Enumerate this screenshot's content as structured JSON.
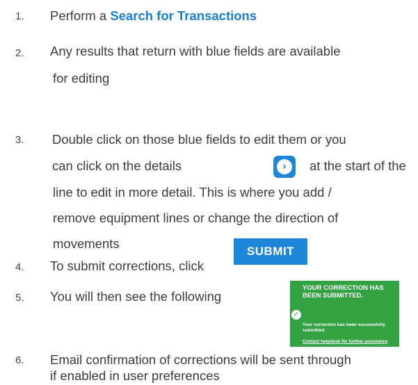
{
  "steps": [
    {
      "number": "1.",
      "prefix": "Perform a ",
      "link": "Search for Transactions"
    },
    {
      "number": "2.",
      "lines": [
        "Any results that return with blue fields are available",
        "for editing"
      ]
    },
    {
      "number": "3.",
      "line1": "Double click on those blue fields to edit them or you",
      "line2_before": "can click on the details",
      "line2_after": "at the start of the",
      "lines_rest": [
        "line to edit in more detail. This is where you add /",
        "remove equipment lines or change the direction of",
        "movements"
      ]
    },
    {
      "number": "4.",
      "text": "To submit corrections, click"
    },
    {
      "number": "5.",
      "text": "You will then see the following"
    },
    {
      "number": "6.",
      "lines": [
        "Email confirmation of corrections will be sent through",
        "if enabled in user preferences"
      ]
    }
  ],
  "details_icon": "chevron-right-icon",
  "submit_button": {
    "label": "SUBMIT",
    "color": "#1e86d8"
  },
  "confirmation": {
    "title": "YOUR CORRECTION HAS BEEN SUBMITTED.",
    "message": "Your correction has been successfully submitted.",
    "helpdesk_link": "Contact helpdesk for further assistance",
    "color": "#32a242",
    "icon": "check-icon"
  },
  "colors": {
    "link": "#1b7fd1",
    "text": "#3c3c3c"
  }
}
